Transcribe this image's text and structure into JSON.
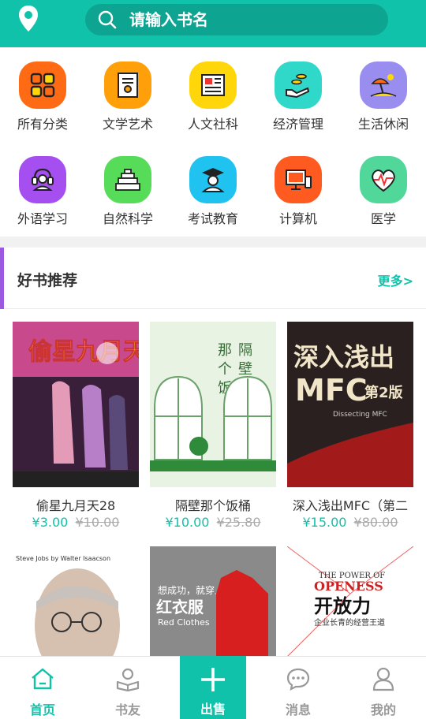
{
  "header": {
    "search_placeholder": "请输入书名"
  },
  "categories": [
    {
      "label": "所有分类",
      "icon": "grid-icon",
      "color": "#ff6a14"
    },
    {
      "label": "文学艺术",
      "icon": "certificate-icon",
      "color": "#ff9f0a"
    },
    {
      "label": "人文社科",
      "icon": "newspaper-icon",
      "color": "#ffd60a"
    },
    {
      "label": "经济管理",
      "icon": "coins-hand-icon",
      "color": "#2fd8c8"
    },
    {
      "label": "生活休闲",
      "icon": "beach-umbrella-icon",
      "color": "#9a8df0"
    },
    {
      "label": "外语学习",
      "icon": "headset-icon",
      "color": "#a64ff0"
    },
    {
      "label": "自然科学",
      "icon": "pyramid-icon",
      "color": "#57dc5a"
    },
    {
      "label": "考试教育",
      "icon": "graduate-icon",
      "color": "#20c3f0"
    },
    {
      "label": "计算机",
      "icon": "computer-icon",
      "color": "#ff5a1f"
    },
    {
      "label": "医学",
      "icon": "heartbeat-icon",
      "color": "#52d79a"
    }
  ],
  "section": {
    "title": "好书推荐",
    "more": "更多>"
  },
  "books": [
    {
      "name": "偷星九月天28",
      "price": "¥3.00",
      "original_price": "¥10.00"
    },
    {
      "name": "隔壁那个饭桶",
      "price": "¥10.00",
      "original_price": "¥25.80"
    },
    {
      "name": "深入浅出MFC（第二",
      "price": "¥15.00",
      "original_price": "¥80.00"
    },
    {
      "name": "",
      "price": "",
      "original_price": ""
    },
    {
      "name": "",
      "price": "",
      "original_price": ""
    },
    {
      "name": "",
      "price": "",
      "original_price": ""
    }
  ],
  "covers": {
    "c2": {
      "t1": "那",
      "t2": "个",
      "t3": "饭",
      "t4": "隔",
      "t5": "壁",
      "t6": "桶"
    },
    "c3": {
      "top": "深入浅出",
      "mfc": "MFC",
      "ed": "第2版",
      "sub": "Dissecting MFC"
    },
    "c4": {
      "top": "Steve Jobs by Walter Isaacson"
    },
    "c5": {
      "t1": "想成功，就穿上",
      "t2": "红衣服",
      "t3": "Red Clothes"
    },
    "c6": {
      "t1": "THE POWER OF",
      "t2": "OPENESS",
      "t3": "开放力",
      "t4": "企业长青的经营王道"
    }
  },
  "nav": [
    {
      "label": "首页",
      "icon": "home-icon"
    },
    {
      "label": "书友",
      "icon": "reader-icon"
    },
    {
      "label": "出售",
      "icon": "plus-icon"
    },
    {
      "label": "消息",
      "icon": "chat-icon"
    },
    {
      "label": "我的",
      "icon": "user-icon"
    }
  ],
  "colors": {
    "accent": "#11c2aa",
    "section_bar": "#9b59e0"
  }
}
